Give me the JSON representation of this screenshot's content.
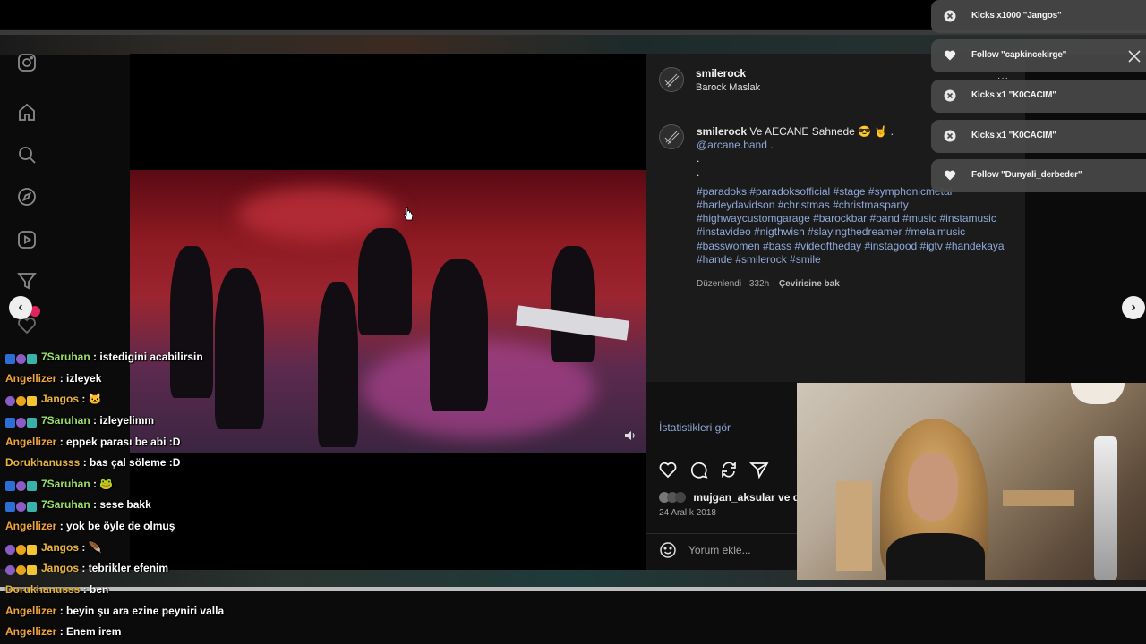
{
  "post": {
    "author_username": "smilerock",
    "author_subtitle": "Barock Maslak",
    "caption_user": "smilerock",
    "caption_text": " Ve AECANE Sahnede 😎 🤘 .",
    "mention": "@arcane.band",
    "mention_suffix": " .",
    "dot_lines": [
      ".",
      "."
    ],
    "hashtags": "#paradoks #paradoksofficial #stage #symphonicmetal #harleydavidson #christmas #christmasparty #highwaycustomgarage #barockbar #band #music #instamusic #instavideo #nigthwish #slayingthedreamer #metalmusic #basswomen #bass #videoftheday #instagood #igtv #handekaya #hande #smilerock #smile",
    "edited_meta": "Düzenlendi · 332h",
    "translate_link": "Çevirisine bak",
    "stats_link": "İstatistikleri gör",
    "likes_text": "mujgan_aksular ve d",
    "date": "24 Aralık 2018",
    "comment_placeholder": "Yorum ekle..."
  },
  "icons": {
    "rail": [
      "instagram-icon",
      "home-icon",
      "search-icon",
      "explore-icon",
      "reels-icon",
      "notifications-icon",
      "heart-icon"
    ],
    "actions": [
      "like-icon",
      "comment-icon",
      "repost-icon",
      "share-icon"
    ]
  },
  "alerts": [
    {
      "icon": "kick-icon",
      "text": "Kicks x1000 \"Jangos\""
    },
    {
      "icon": "heart-icon",
      "text": "Follow \"capkincekirge\""
    },
    {
      "icon": "kick-icon",
      "text": "Kicks x1 \"K0CACIM\""
    },
    {
      "icon": "kick-icon",
      "text": "Kicks x1 \"K0CACIM\""
    },
    {
      "icon": "heart-icon",
      "text": "Follow \"Dunyali_derbeder\""
    }
  ],
  "alert_dots": "···",
  "chat": [
    {
      "badges": [
        "blue",
        "purple",
        "teal"
      ],
      "nick": "7Saruhan",
      "color": "green",
      "msg": "istedigini acabilirsin"
    },
    {
      "badges": [],
      "nick": "Angellizer",
      "color": "orange",
      "msg": "izleyek"
    },
    {
      "badges": [
        "purple",
        "gold",
        "yellow"
      ],
      "nick": "Jangos",
      "color": "gold",
      "msg": "🐱"
    },
    {
      "badges": [
        "blue",
        "purple",
        "teal"
      ],
      "nick": "7Saruhan",
      "color": "green",
      "msg": "izleyelimm"
    },
    {
      "badges": [],
      "nick": "Angellizer",
      "color": "orange",
      "msg": "eppek parası be abi :D"
    },
    {
      "badges": [],
      "nick": "Dorukhanusss",
      "color": "gold",
      "msg": "bas çal söleme :D"
    },
    {
      "badges": [
        "blue",
        "purple",
        "teal"
      ],
      "nick": "7Saruhan",
      "color": "green",
      "msg": "🐸"
    },
    {
      "badges": [
        "blue",
        "purple",
        "teal"
      ],
      "nick": "7Saruhan",
      "color": "green",
      "msg": "sese bakk"
    },
    {
      "badges": [],
      "nick": "Angellizer",
      "color": "orange",
      "msg": "yok be öyle de olmuş"
    },
    {
      "badges": [
        "purple",
        "gold",
        "yellow"
      ],
      "nick": "Jangos",
      "color": "gold",
      "msg": "🪶"
    },
    {
      "badges": [
        "purple",
        "gold",
        "yellow"
      ],
      "nick": "Jangos",
      "color": "gold",
      "msg": "tebrikler efenim"
    },
    {
      "badges": [],
      "nick": "Dorukhanusss",
      "color": "gold",
      "msg": "ben"
    },
    {
      "badges": [],
      "nick": "Angellizer",
      "color": "orange",
      "msg": "beyin şu ara ezine peyniri valla"
    },
    {
      "badges": [],
      "nick": "Angellizer",
      "color": "orange",
      "msg": "Enem irem"
    }
  ],
  "colors": {
    "link": "#8fa8d8",
    "nick_green": "#9adf6a",
    "nick_orange": "#f0a43c",
    "nick_gold": "#e9b43a"
  }
}
